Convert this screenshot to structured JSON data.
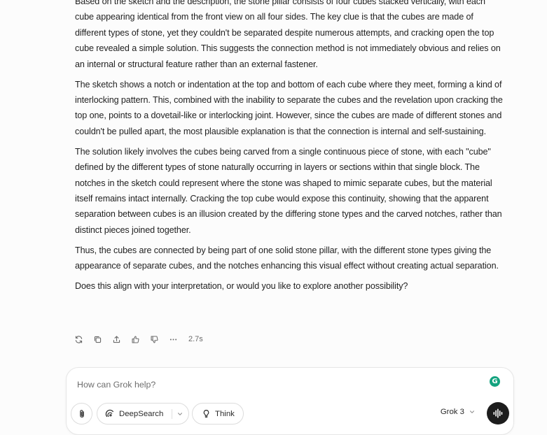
{
  "answer": {
    "paragraphs": [
      "Based on the sketch and the description, the stone pillar consists of four cubes stacked vertically, with each cube appearing identical from the front view on all four sides. The key clue is that the cubes are made of different types of stone, yet they couldn't be separated despite numerous attempts, and cracking open the top cube revealed a simple solution. This suggests the connection method is not immediately obvious and relies on an internal or structural feature rather than an external fastener.",
      "The sketch shows a notch or indentation at the top and bottom of each cube where they meet, forming a kind of interlocking pattern. This, combined with the inability to separate the cubes and the revelation upon cracking the top one, points to a dovetail-like or interlocking joint. However, since the cubes are made of different stones and couldn't be pulled apart, the most plausible explanation is that the connection is internal and self-sustaining.",
      "The solution likely involves the cubes being carved from a single continuous piece of stone, with each \"cube\" defined by the different types of stone naturally occurring in layers or sections within that single block. The notches in the sketch could represent where the stone was shaped to mimic separate cubes, but the material itself remains intact internally. Cracking the top cube would expose this continuity, showing that the apparent separation between cubes is an illusion created by the differing stone types and the carved notches, rather than distinct pieces joined together.",
      "Thus, the cubes are connected by being part of one solid stone pillar, with the different stone types giving the appearance of separate cubes, and the notches enhancing this visual effect without creating actual separation.",
      "Does this align with your interpretation, or would you like to explore another possibility?"
    ]
  },
  "actions": {
    "icons": [
      "regenerate-icon",
      "copy-icon",
      "share-icon",
      "thumbs-up-icon",
      "thumbs-down-icon",
      "more-icon"
    ],
    "response_time": "2.7s"
  },
  "composer": {
    "placeholder": "How can Grok help?",
    "deepsearch_label": "DeepSearch",
    "think_label": "Think",
    "model_label": "Grok 3",
    "grammarly_letter": "G"
  },
  "colors": {
    "background": "#fcfcfc",
    "text": "#1f1f1f",
    "voice_button": "#1d1d1d",
    "grammarly": "#14a37f"
  }
}
